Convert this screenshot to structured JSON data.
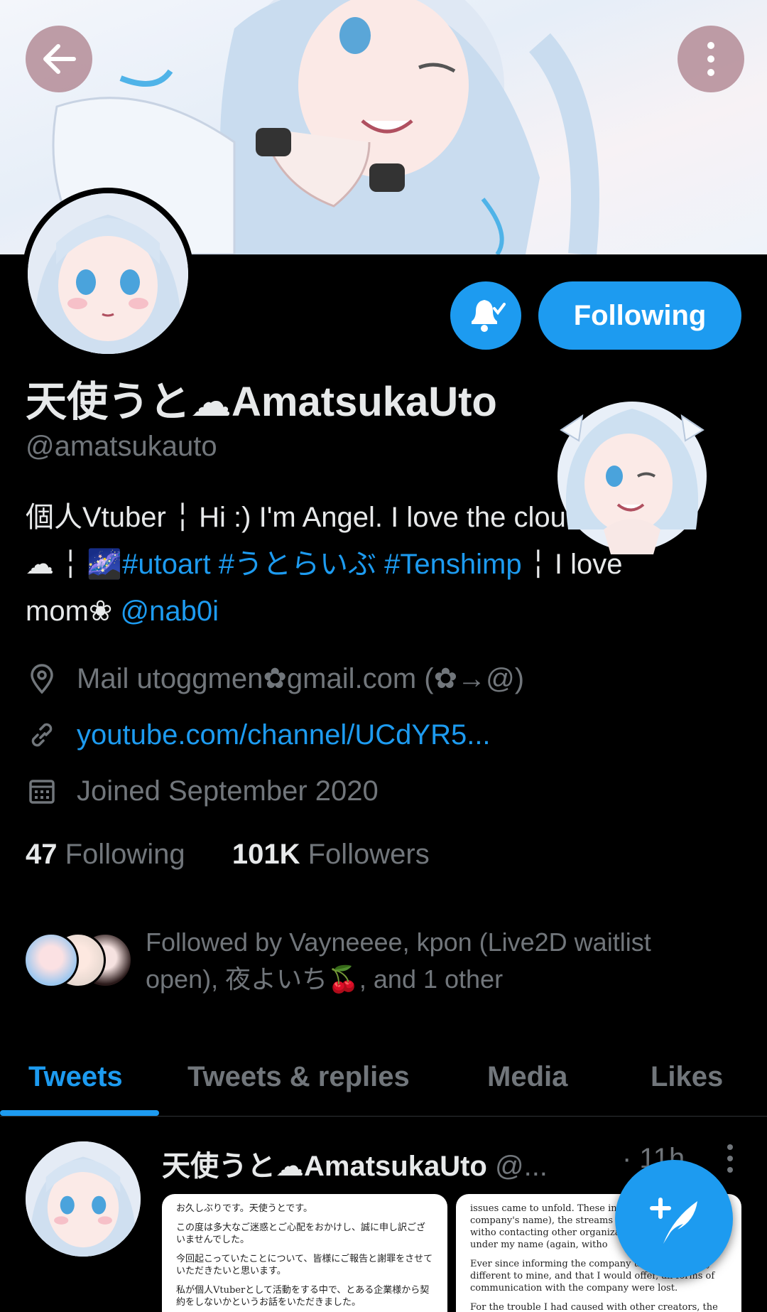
{
  "profile": {
    "display_name": "天使うと☁AmatsukaUto",
    "handle": "@amatsukauto",
    "bio": {
      "line1": "個人Vtuber ╎ Hi :) I'm Angel. I love the clouds",
      "line2_prefix": "☁ ╎ 🌌",
      "tags": "#utoart #うとらいぶ #Tenshimp",
      "line2_suffix": " ╎ I love",
      "line3_prefix": "mom❀ ",
      "mention": "@nab0i"
    },
    "location": "Mail utoggmen✿gmail.com (✿→@)",
    "website": "youtube.com/channel/UCdYR5...",
    "joined": "Joined September 2020",
    "following_count": "47",
    "following_label": "Following",
    "followers_count": "101K",
    "followers_label": "Followers",
    "followed_by": "Followed by Vayneeee, kpon (Live2D waitlist open), 夜よいち🍒, and 1 other"
  },
  "buttons": {
    "follow_label": "Following"
  },
  "tabs": [
    {
      "label": "Tweets"
    },
    {
      "label": "Tweets & replies"
    },
    {
      "label": "Media"
    },
    {
      "label": "Likes"
    }
  ],
  "tweet": {
    "name": "天使うと☁AmatsukaUto",
    "handle": "@...",
    "time": "· 11h",
    "doc_left": [
      "お久しぶりです。天使うとです。",
      "この度は多大なご迷惑とご心配をおかけし、誠に申し訳ございませんでした。",
      "今回起こっていたことについて、皆様にご報告と謝罪をさせていただきたいと思います。",
      "私が個人Vtuberとして活動をする中で、とある企業様から契約をしないかというお話をいただきました。"
    ],
    "doc_right": [
      "issues came to unfold. These include, (not under the company's name), the streams with unrelated vtubers witho contacting other organizations and co contracts under my name (again, witho",
      "Ever since informing the company that th distinctly different to mine, and that I would offer, all forms of communication with the company were lost.",
      "For the trouble I had caused with other creators, the meta-tagging incident, and my late response due to the uncertainty of"
    ]
  },
  "colors": {
    "accent": "#1d9bf0",
    "background": "#000000",
    "secondary_text": "#71767b"
  },
  "icons": {
    "back": "arrow-left-icon",
    "more": "more-vertical-icon",
    "bell": "bell-check-icon",
    "location": "location-pin-icon",
    "link": "link-icon",
    "calendar": "calendar-icon",
    "compose": "compose-feather-icon"
  }
}
